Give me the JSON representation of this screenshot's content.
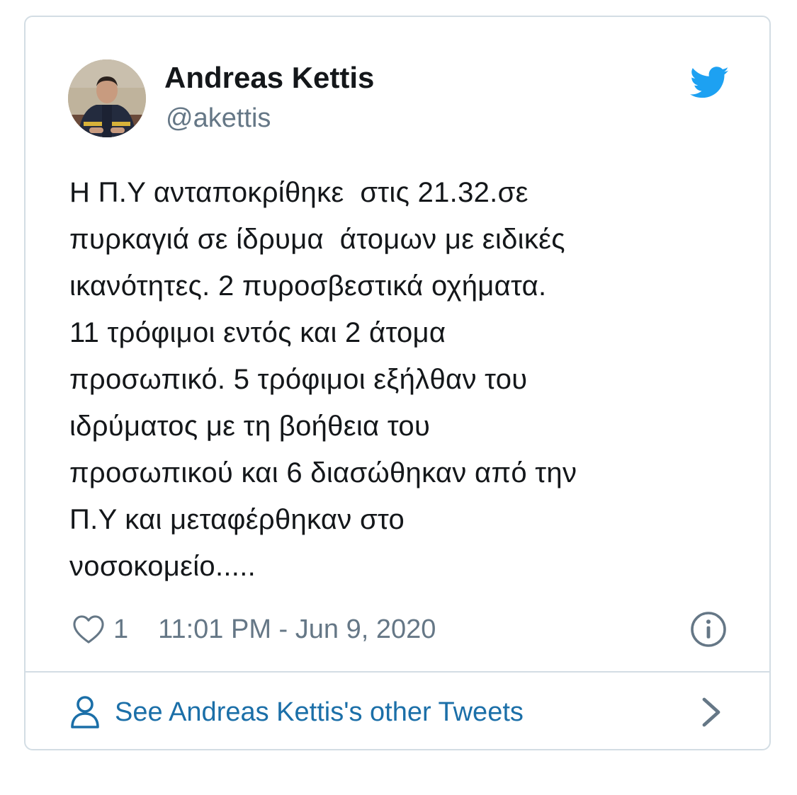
{
  "tweet": {
    "author": {
      "name": "Andreas Kettis",
      "handle": "@akettis",
      "avatar": "profile-photo"
    },
    "text": "Η Π.Υ ανταποκρίθηκε  στις 21.32.σε\nπυρκαγιά σε ίδρυμα  άτομων με ειδικές\nικανότητες. 2 πυροσβεστικά οχήματα.\n11 τρόφιμοι εντός και 2 άτομα\nπροσωπικό. 5 τρόφιμοι εξήλθαν του\nιδρύματος με τη βοήθεια του\nπροσωπικού και 6 διασώθηκαν από την\nΠ.Υ και μεταφέρθηκαν στο\nνοσοκομείο.....",
    "likes": "1",
    "timestamp": "11:01 PM - Jun 9, 2020",
    "see_other_label": "See Andreas Kettis's other Tweets"
  },
  "icons": {
    "brand": "twitter-bird-icon",
    "like": "heart-icon",
    "info": "info-icon",
    "profile": "person-icon",
    "more": "chevron-right-icon"
  },
  "colors": {
    "twitter_blue": "#1da1f2",
    "link_blue": "#1b6fa8",
    "text_primary": "#14171a",
    "text_secondary": "#657786",
    "border": "#d3dde4"
  }
}
